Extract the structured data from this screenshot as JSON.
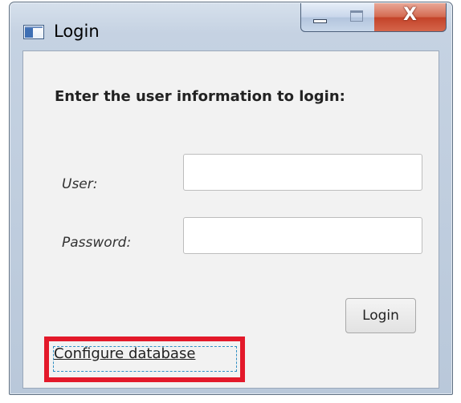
{
  "window": {
    "title": "Login",
    "icon": "app-window-icon",
    "controls": {
      "close_glyph": "X"
    }
  },
  "form": {
    "heading": "Enter the user information to login:",
    "user_label": "User:",
    "user_value": "",
    "password_label": "Password:",
    "password_value": "",
    "login_button": "Login",
    "configure_link": "Configure database"
  },
  "colors": {
    "highlight": "#e3192a",
    "focus_ring": "#2f8fc4",
    "client_background": "#f2f2f2"
  }
}
